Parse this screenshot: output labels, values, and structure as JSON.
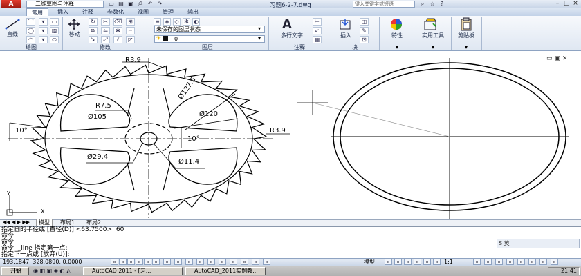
{
  "titlebar": {
    "logo": "A",
    "workspace": "二维草图与注释",
    "doc_title": "习题6-2-7.dwg",
    "search_placeholder": "键入关键字或短语",
    "window_controls": [
      "–",
      "□",
      "×"
    ]
  },
  "ribbon": {
    "tabs": [
      {
        "label": "常用",
        "active": true
      },
      {
        "label": "插入"
      },
      {
        "label": "注释"
      },
      {
        "label": "参数化"
      },
      {
        "label": "视图"
      },
      {
        "label": "管理"
      },
      {
        "label": "输出"
      }
    ],
    "line_label": "直线",
    "move_label": "移动",
    "layer_state": "未保存的图层状态",
    "layer_current": "0",
    "multiline_text_label": "多行文字",
    "insert_label": "插入",
    "properties_label": "特性",
    "utilities_label": "实用工具",
    "clipboard_label": "剪贴板",
    "panels": {
      "draw": "绘图",
      "modify": "修改",
      "layers": "图层",
      "annotation": "注释",
      "block": "块"
    }
  },
  "drawing": {
    "dims": {
      "r3_9_top": "R3.9",
      "r7_5": "R7.5",
      "d105": "Ø105",
      "d127_5": "Ø127.5",
      "d120": "Ø120",
      "r3_9_right": "R3.9",
      "angle_left": "10°",
      "angle_center": "10°",
      "d29_4": "Ø29.4",
      "d11_4": "Ø11.4"
    },
    "ucs_y": "Y",
    "ucs_x": "X"
  },
  "layout_tabs": [
    "模型",
    "布局1",
    "布局2"
  ],
  "command": {
    "lines": [
      "指定圆的半径或 [直径(D)] <63.7500>: 60",
      "命令:",
      "命令:",
      "命令: _line 指定第一点:",
      "指定下一点或 [放弃(U)]:"
    ],
    "ime": "S 英"
  },
  "status": {
    "coords": "193.1847, 328.0890, 0.0000",
    "model": "模型",
    "scale": "1:1"
  },
  "taskbar": {
    "start": "开始",
    "tasks": [
      "AutoCAD 2011 - [习...",
      "AutoCAD_2011实例教..."
    ],
    "time": "21:41"
  }
}
